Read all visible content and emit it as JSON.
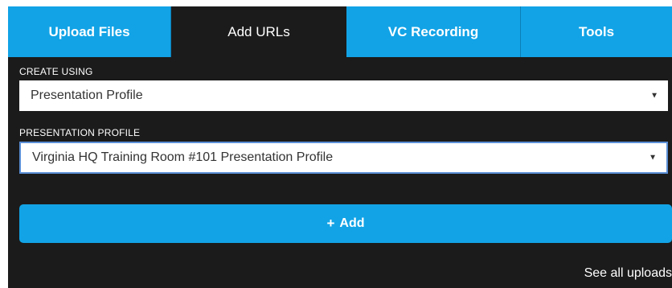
{
  "tabs": [
    {
      "label": "Upload Files",
      "active": false
    },
    {
      "label": "Add URLs",
      "active": true
    },
    {
      "label": "VC Recording",
      "active": false
    },
    {
      "label": "Tools",
      "active": false
    }
  ],
  "create_using": {
    "label": "CREATE USING",
    "value": "Presentation Profile",
    "caret_icon": "caret-down-icon"
  },
  "presentation_profile": {
    "label": "PRESENTATION PROFILE",
    "value": "Virginia HQ Training Room #101 Presentation Profile",
    "caret_icon": "caret-down-icon"
  },
  "add_button": {
    "icon": "+",
    "label": "Add"
  },
  "footer": {
    "see_all_label": "See all uploads"
  },
  "colors": {
    "accent": "#12a3e6",
    "panel_background": "#1b1b1b",
    "focus_border": "#5b8fd6"
  }
}
